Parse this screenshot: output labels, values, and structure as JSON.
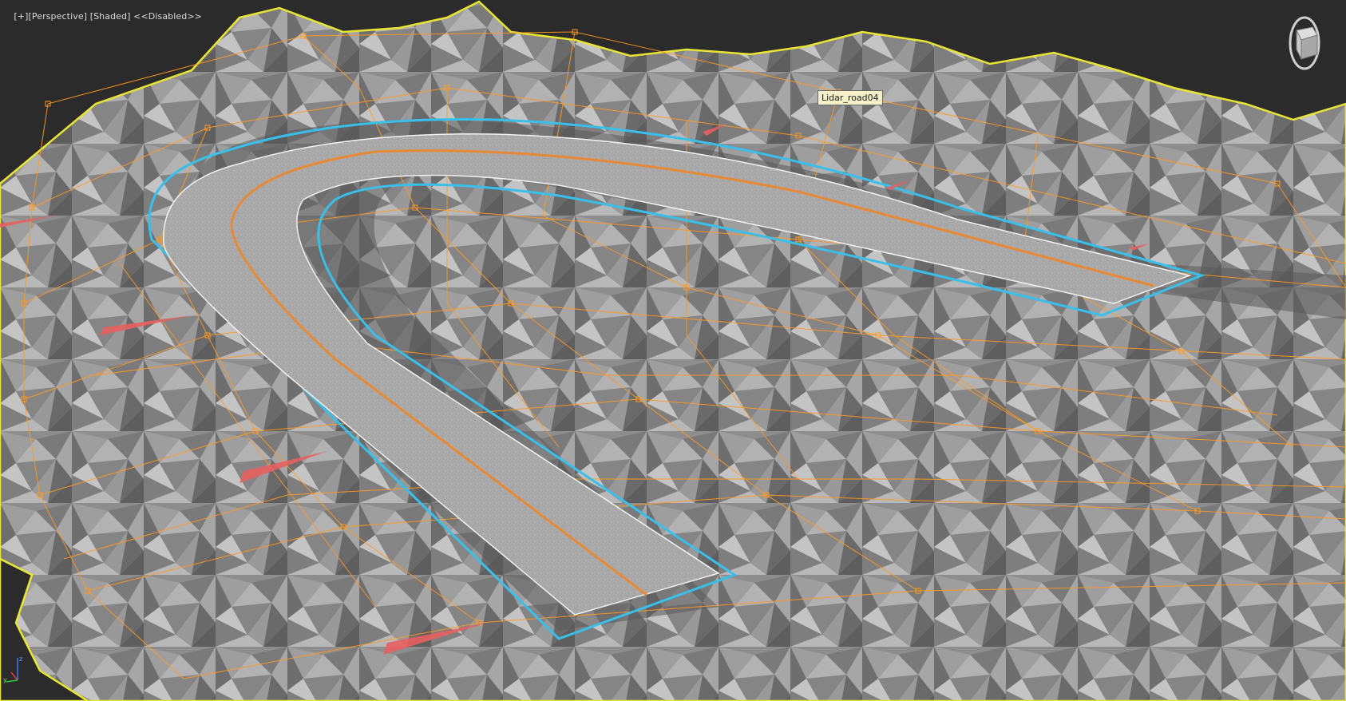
{
  "viewport": {
    "menu_plus": "[+]",
    "view_name": "[Perspective]",
    "shading": "[Shaded]",
    "extra": "<<Disabled>>"
  },
  "tooltip": {
    "object_name": "Lidar_road04"
  },
  "axis_tripod": {
    "z": "z",
    "x": "x",
    "y": "y"
  },
  "colors": {
    "terrain": "#8d8d8d",
    "terrain_outline": "#e6e633",
    "lattice": "#ff9a1f",
    "road_outline": "#39c0ea",
    "road_surface": "#a9a9a9",
    "center_line": "#e88a35",
    "red_marker": "#e86060",
    "background": "#2b2b2b"
  },
  "icons": [
    "viewcube-icon",
    "axis-tripod-icon"
  ]
}
